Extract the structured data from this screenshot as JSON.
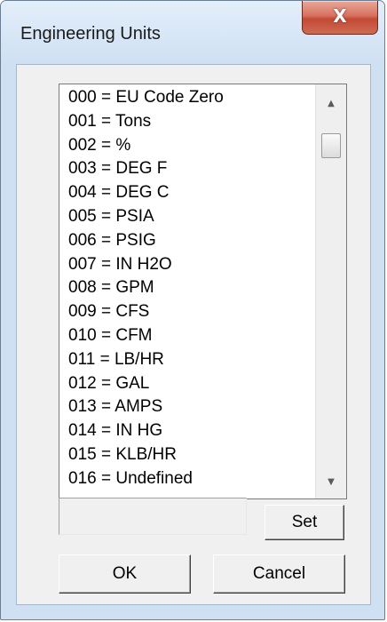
{
  "window": {
    "title": "Engineering Units",
    "close_glyph": "X"
  },
  "unit_list": {
    "items": [
      "000 = EU Code Zero",
      "001 = Tons",
      "002 = %",
      "003 = DEG F",
      "004 = DEG C",
      "005 = PSIA",
      "006 = PSIG",
      "007 = IN H2O",
      "008 = GPM",
      "009 = CFS",
      "010 = CFM",
      "011 = LB/HR",
      "012 = GAL",
      "013 = AMPS",
      "014 = IN HG",
      "015 = KLB/HR",
      "016 = Undefined"
    ],
    "scroll_up_glyph": "▲",
    "scroll_down_glyph": "▼"
  },
  "value_field": {
    "value": ""
  },
  "buttons": {
    "set_label": "Set",
    "ok_label": "OK",
    "cancel_label": "Cancel"
  }
}
